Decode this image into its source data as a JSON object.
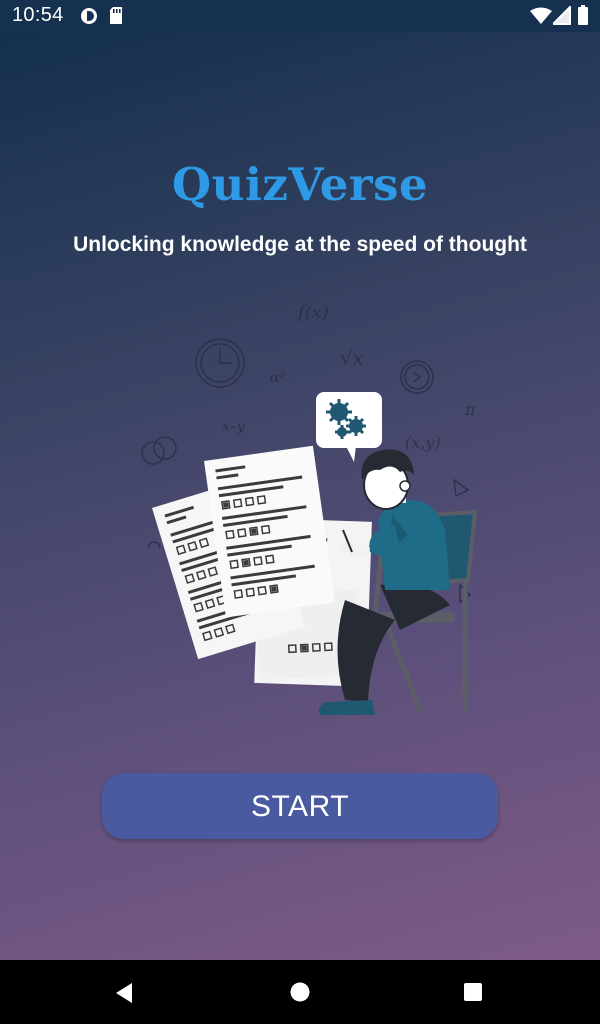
{
  "status_bar": {
    "time": "10:54",
    "icons": [
      "data-saver-icon",
      "sd-card-icon",
      "wifi-icon",
      "cell-signal-icon",
      "battery-icon"
    ]
  },
  "app": {
    "title": "QuizVerse",
    "tagline": "Unlocking knowledge at the speed of thought",
    "start_label": "START",
    "illustration": "student-solving-quiz-illustration",
    "colors": {
      "title": "#2e9ae6",
      "button": "#4a5aa0",
      "gradient_top": "#13304d",
      "gradient_bottom": "#7e5b86"
    }
  },
  "nav_bar": {
    "buttons": [
      "back-icon",
      "home-icon",
      "recents-icon"
    ]
  }
}
